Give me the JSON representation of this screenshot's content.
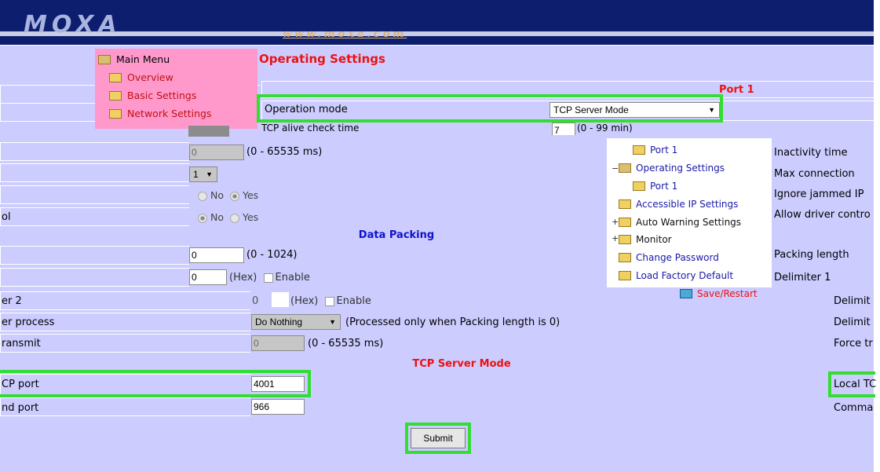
{
  "header": {
    "logo": "MOXA",
    "url": "www.moxa.com"
  },
  "menu": {
    "title": "Main Menu",
    "items": [
      "Overview",
      "Basic Settings",
      "Network Settings"
    ]
  },
  "page_title": "Operating Settings",
  "port_header": "Port 1",
  "operation_mode": {
    "label": "Operation mode",
    "value": "TCP Server Mode"
  },
  "tcp_alive": {
    "label": "TCP alive check time",
    "value": "7",
    "range": "(0 - 99 min)"
  },
  "inactivity": {
    "value": "0",
    "range": "(0 - 65535 ms)"
  },
  "max_connection": {
    "value": "1"
  },
  "radio": {
    "no": "No",
    "yes": "Yes"
  },
  "partial_left_labels": [
    "ol",
    "er 2",
    "er process",
    "ransmit",
    "CP port",
    "nd port"
  ],
  "sections": {
    "data_packing": "Data Packing",
    "tcp_server_mode": "TCP Server Mode"
  },
  "packing_length": {
    "value": "0",
    "range": "(0 - 1024)"
  },
  "delimiter1": {
    "value": "0",
    "hex": "(Hex)",
    "enable": "Enable"
  },
  "delimiter2": {
    "value": "0",
    "hex": "(Hex)",
    "enable": "Enable"
  },
  "delimiter_process": {
    "value": "Do Nothing",
    "note": "(Processed only when Packing length is 0)"
  },
  "force_transmit": {
    "value": "0",
    "range": "(0 - 65535 ms)"
  },
  "local_tcp_port": {
    "value": "4001"
  },
  "command_port": {
    "value": "966"
  },
  "tree": {
    "items": [
      "Port 1",
      "Operating Settings",
      "Port 1",
      "Accessible IP Settings",
      "Auto Warning Settings",
      "Monitor",
      "Change Password",
      "Load Factory Default",
      "Save/Restart"
    ]
  },
  "right_labels": [
    "Inactivity time",
    "Max connection",
    "Ignore jammed IP",
    "Allow driver contro",
    "Packing length",
    "Delimiter 1",
    "Delimit",
    "Delimit",
    "Force tr",
    "Local TC",
    "Comma"
  ],
  "submit_label": "Submit",
  "colors": {
    "highlight": "#33dd33",
    "menu_bg": "#ff99cc",
    "content_bg": "#ccccff",
    "title_red": "#ee1111",
    "section_blue": "#1111cc"
  }
}
